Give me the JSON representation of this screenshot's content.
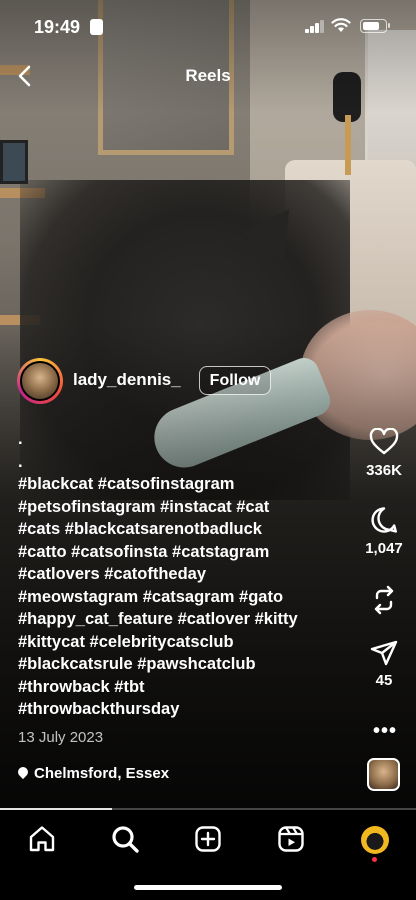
{
  "status_bar": {
    "time": "19:49"
  },
  "header": {
    "title": "Reels"
  },
  "author": {
    "username": "lady_dennis_",
    "follow_label": "Follow"
  },
  "caption": {
    "lines": [
      ".",
      ".",
      "#blackcat #catsofinstagram",
      "#petsofinstagram #instacat #cat",
      "#cats #blackcatsarenotbadluck",
      "#catto #catsofinsta #catstagram",
      "#catlovers #catoftheday",
      "#meowstagram #catsagram #gato",
      "#happy_cat_feature #catlover  #kitty",
      "#kittycat #celebritycatsclub",
      "#blackcatsrule  #pawshcatclub",
      "#throwback #tbt",
      "#throwbackthursday"
    ],
    "date": "13 July 2023",
    "location": "Chelmsford, Essex"
  },
  "actions": {
    "likes": "336K",
    "comments": "1,047",
    "shares": "45",
    "more": "•••"
  },
  "progress": 0.27,
  "battery_level": 0.8,
  "icons": {
    "back": "chevron-left-icon",
    "like": "heart-icon",
    "comment": "comment-bubble-icon",
    "repost": "repost-icon",
    "share": "paper-plane-icon",
    "nav": [
      "home-icon",
      "search-icon",
      "create-icon",
      "reels-icon",
      "profile-avatar"
    ]
  }
}
